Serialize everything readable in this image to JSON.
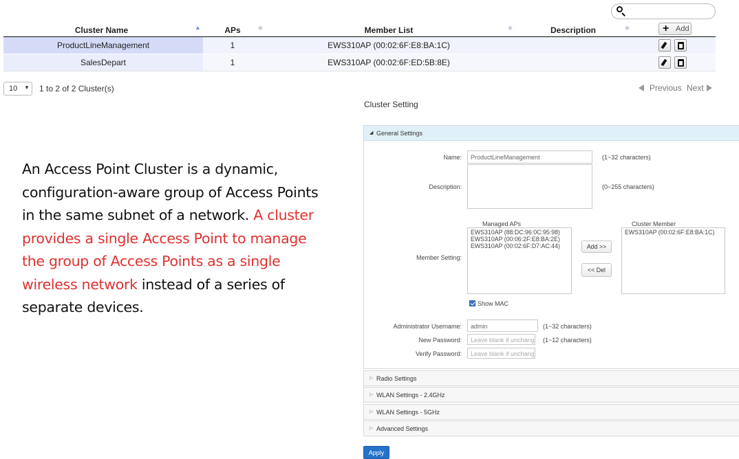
{
  "table": {
    "headers": {
      "name": "Cluster Name",
      "aps": "APs",
      "members": "Member List",
      "description": "Description"
    },
    "add_label": "Add",
    "rows": [
      {
        "name": "ProductLineManagement",
        "aps": "1",
        "members": "EWS310AP (00:02:6F:E8:BA:1C)"
      },
      {
        "name": "SalesDepart",
        "aps": "1",
        "members": "EWS310AP (00:02:6F:ED:5B:8E)"
      }
    ]
  },
  "pager": {
    "page_size": "10",
    "info": "1 to 2 of 2 Cluster(s)",
    "previous": "Previous",
    "next": "Next"
  },
  "description_text": {
    "part1": "An Access Point Cluster is a dynamic, configuration-aware group of Access Points in the same subnet of a network.",
    "highlight": " A cluster provides a single Access Point to manage the group of Access Points as a single wireless network",
    "part2": " instead of a series of separate devices."
  },
  "colors": {
    "highlight": "#e03030",
    "apply": "#2572c9",
    "panel_head": "#dff0f9"
  },
  "cluster_setting": {
    "title": "Cluster Setting",
    "general": {
      "title": "General Settings",
      "name_label": "Name:",
      "name_value": "ProductLineManagement",
      "name_hint": "(1~32 characters)",
      "description_label": "Description:",
      "description_hint": "(0~255 characters)",
      "member_label": "Member Setting:",
      "managed_title": "Managed APs",
      "managed_aps": [
        "EWS310AP (88:DC:96:0C:95:98)",
        "EWS310AP (00:06:2F:E8:BA:2E)",
        "EWS310AP (00:02:6F:D7:AC:44)"
      ],
      "member_title": "Cluster Member",
      "members": [
        "EWS310AP (00:02:6F:E8:BA:1C)"
      ],
      "add_btn": "Add >>",
      "del_btn": "<< Del",
      "show_mac": "Show MAC",
      "admin_label": "Administrator Username:",
      "admin_value": "admin",
      "admin_hint": "(1~32 characters)",
      "newpw_label": "New Password:",
      "newpw_placeholder": "Leave blank if unchang",
      "newpw_hint": "(1~12 characters)",
      "verifypw_label": "Verify Password:",
      "verifypw_placeholder": "Leave blank if unchang"
    },
    "sections": [
      "Radio Settings",
      "WLAN Settings - 2.4GHz",
      "WLAN Settings - 5GHz",
      "Advanced Settings"
    ],
    "apply": "Apply"
  }
}
